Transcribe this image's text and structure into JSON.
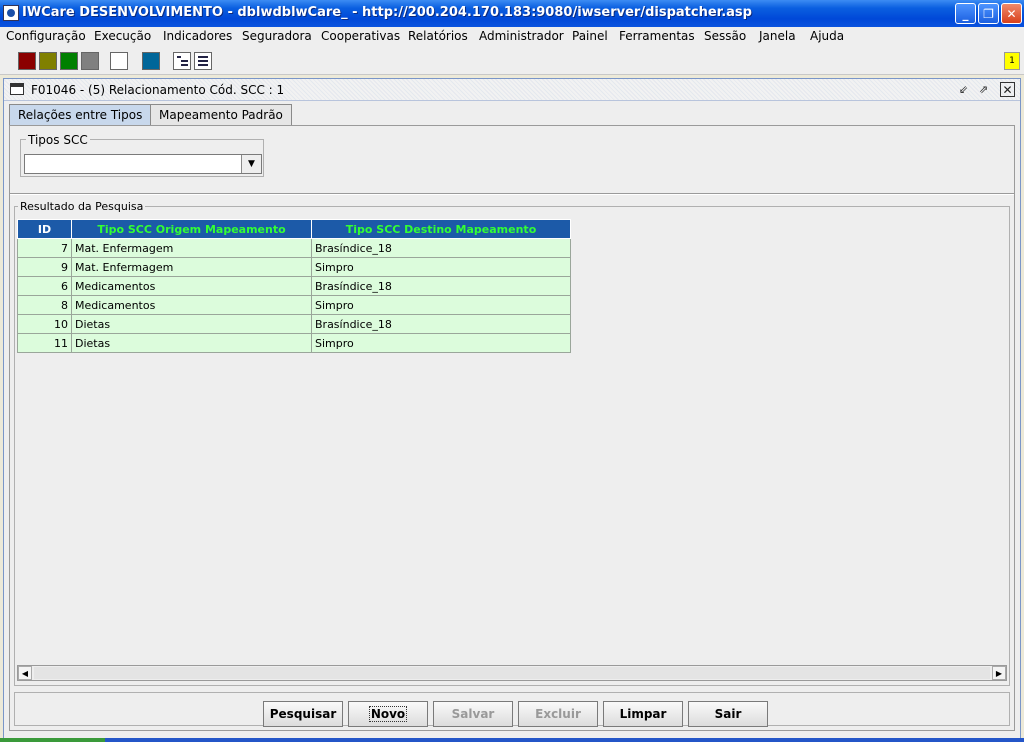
{
  "window": {
    "title": "IWCare DESENVOLVIMENTO - dblwdblwCare_ - http://200.204.170.183:9080/iwserver/dispatcher.asp"
  },
  "menu": [
    "Configuração",
    "Execução",
    "Indicadores",
    "Seguradora",
    "Cooperativas",
    "Relatórios",
    "Administrador",
    "Painel",
    "Ferramentas",
    "Sessão",
    "Janela",
    "Ajuda"
  ],
  "toolbar": {
    "swatch_colors": [
      "#8b0000",
      "#808000",
      "#008000",
      "#808080",
      "#ffffff",
      "#006699"
    ],
    "badge": "1"
  },
  "frame": {
    "title": "F01046 - (5) Relacionamento Cód. SCC : 1"
  },
  "tabs": [
    "Relações entre Tipos",
    "Mapeamento Padrão"
  ],
  "tipos": {
    "legend": "Tipos SCC",
    "value": ""
  },
  "result": {
    "legend": "Resultado da Pesquisa",
    "columns": [
      "ID",
      "Tipo SCC Origem Mapeamento",
      "Tipo SCC Destino Mapeamento"
    ],
    "rows": [
      {
        "id": "7",
        "origem": "Mat. Enfermagem",
        "destino": "Brasíndice_18"
      },
      {
        "id": "9",
        "origem": "Mat. Enfermagem",
        "destino": "Simpro"
      },
      {
        "id": "6",
        "origem": "Medicamentos",
        "destino": "Brasíndice_18"
      },
      {
        "id": "8",
        "origem": "Medicamentos",
        "destino": "Simpro"
      },
      {
        "id": "10",
        "origem": "Dietas",
        "destino": "Brasíndice_18"
      },
      {
        "id": "11",
        "origem": "Dietas",
        "destino": "Simpro"
      }
    ]
  },
  "buttons": {
    "pesquisar": "Pesquisar",
    "novo": "Novo",
    "salvar": "Salvar",
    "excluir": "Excluir",
    "limpar": "Limpar",
    "sair": "Sair"
  }
}
